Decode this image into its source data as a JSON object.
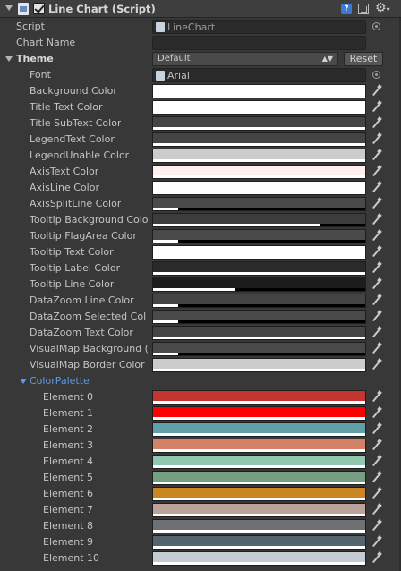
{
  "header": {
    "title": "Line Chart (Script)",
    "icons": [
      "script-icon",
      "enable-checkbox",
      "help-icon",
      "preset-icon",
      "gear-icon"
    ]
  },
  "script": {
    "label": "Script",
    "value": "LineChart"
  },
  "chart_name": {
    "label": "Chart Name",
    "value": ""
  },
  "theme": {
    "label": "Theme",
    "selected": "Default",
    "dropdown_arrow": "▲▼",
    "reset_label": "Reset",
    "font": {
      "label": "Font",
      "value": "Arial"
    },
    "colors": [
      {
        "label": "Background Color",
        "color": "#ffffff",
        "alpha": 1.0
      },
      {
        "label": "Title Text Color",
        "color": "#ffffff",
        "alpha": 1.0
      },
      {
        "label": "Title SubText Color",
        "color": "#444444",
        "alpha": 1.0
      },
      {
        "label": "LegendText Color",
        "color": "#444444",
        "alpha": 1.0
      },
      {
        "label": "LegendUnable Color",
        "color": "#cccccc",
        "alpha": 1.0
      },
      {
        "label": "AxisText Color",
        "color": "#fff0f0",
        "alpha": 1.0
      },
      {
        "label": "AxisLine Color",
        "color": "#ffffff",
        "alpha": 1.0
      },
      {
        "label": "AxisSplitLine Color",
        "color": "#4a4a4a",
        "alpha": 0.12
      },
      {
        "label": "Tooltip Background Colo",
        "color": "#3c3c3c",
        "alpha": 0.79
      },
      {
        "label": "Tooltip FlagArea Color",
        "color": "#4a4a4a",
        "alpha": 0.12
      },
      {
        "label": "Tooltip Text Color",
        "color": "#ffffff",
        "alpha": 1.0
      },
      {
        "label": "Tooltip Label Color",
        "color": "#2a2a2a",
        "alpha": 1.0
      },
      {
        "label": "Tooltip Line Color",
        "color": "#1c1c1c",
        "alpha": 0.39
      },
      {
        "label": "DataZoom Line Color",
        "color": "#444444",
        "alpha": 0.12
      },
      {
        "label": "DataZoom Selected Col",
        "color": "#4a4a4a",
        "alpha": 0.12
      },
      {
        "label": "DataZoom Text Color",
        "color": "#444444",
        "alpha": 1.0
      },
      {
        "label": "VisualMap Background (",
        "color": "#4a4a4a",
        "alpha": 0.12
      },
      {
        "label": "VisualMap Border Color",
        "color": "#cccccc",
        "alpha": 1.0
      }
    ]
  },
  "color_palette": {
    "label": "ColorPalette",
    "elements": [
      {
        "label": "Element 0",
        "color": "#c23531",
        "alpha": 1.0
      },
      {
        "label": "Element 1",
        "color": "#ff0000",
        "alpha": 1.0
      },
      {
        "label": "Element 2",
        "color": "#61a0a8",
        "alpha": 1.0
      },
      {
        "label": "Element 3",
        "color": "#d48265",
        "alpha": 1.0
      },
      {
        "label": "Element 4",
        "color": "#91c7ae",
        "alpha": 1.0
      },
      {
        "label": "Element 5",
        "color": "#749f83",
        "alpha": 1.0
      },
      {
        "label": "Element 6",
        "color": "#ca8622",
        "alpha": 1.0
      },
      {
        "label": "Element 7",
        "color": "#bda29a",
        "alpha": 1.0
      },
      {
        "label": "Element 8",
        "color": "#6e7074",
        "alpha": 1.0
      },
      {
        "label": "Element 9",
        "color": "#546570",
        "alpha": 1.0
      },
      {
        "label": "Element 10",
        "color": "#c4ccd3",
        "alpha": 1.0
      }
    ]
  }
}
